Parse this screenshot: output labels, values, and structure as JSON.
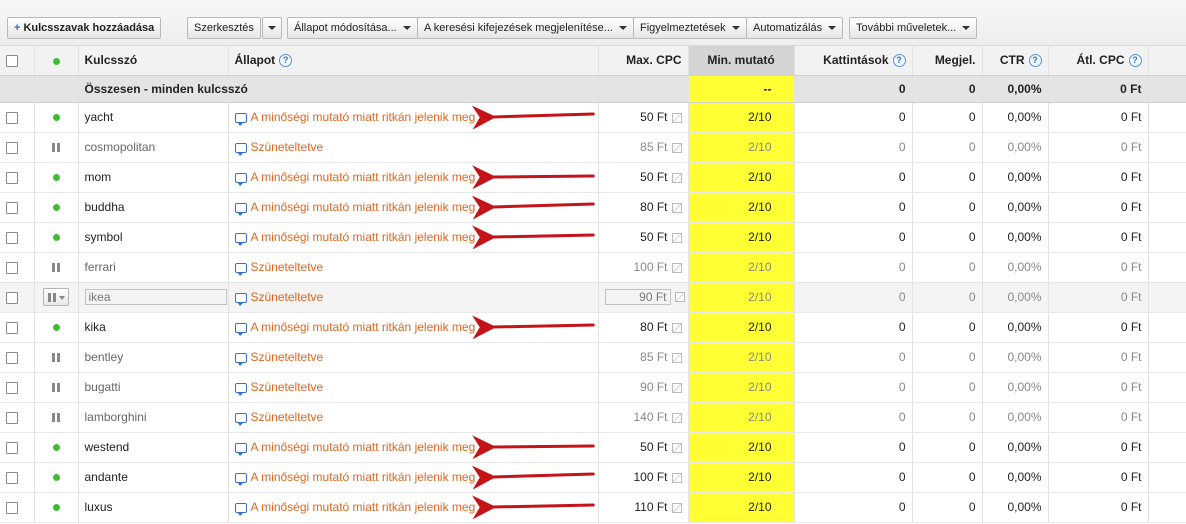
{
  "toolbar": {
    "add_keywords": "Kulcsszavak hozzáadása",
    "edit": "Szerkesztés",
    "change_status": "Állapot módosítása...",
    "search_terms": "A keresési kifejezések megjelenítése...",
    "alerts": "Figyelmeztetések",
    "automate": "Automatizálás",
    "more_actions": "További műveletek..."
  },
  "columns": {
    "keyword": "Kulcsszó",
    "status": "Állapot",
    "max_cpc": "Max. CPC",
    "min_score": "Min. mutató",
    "clicks": "Kattintások",
    "impressions": "Megjel.",
    "ctr": "CTR",
    "avg_cpc": "Átl. CPC"
  },
  "summary": {
    "label": "Összesen - minden kulcsszó",
    "min_score": "--",
    "clicks": "0",
    "impressions": "0",
    "ctr": "0,00%",
    "avg_cpc": "0 Ft"
  },
  "rows": [
    {
      "keyword": "yacht",
      "state": "active",
      "status": "A minőségi mutató miatt ritkán jelenik meg",
      "max_cpc": "50 Ft",
      "min_score": "2/10",
      "clicks": "0",
      "impressions": "0",
      "ctr": "0,00%",
      "avg_cpc": "0 Ft"
    },
    {
      "keyword": "cosmopolitan",
      "state": "paused",
      "status": "Szüneteltetve",
      "max_cpc": "85 Ft",
      "min_score": "2/10",
      "clicks": "0",
      "impressions": "0",
      "ctr": "0,00%",
      "avg_cpc": "0 Ft"
    },
    {
      "keyword": "mom",
      "state": "active",
      "status": "A minőségi mutató miatt ritkán jelenik meg",
      "max_cpc": "50 Ft",
      "min_score": "2/10",
      "clicks": "0",
      "impressions": "0",
      "ctr": "0,00%",
      "avg_cpc": "0 Ft"
    },
    {
      "keyword": "buddha",
      "state": "active",
      "status": "A minőségi mutató miatt ritkán jelenik meg",
      "max_cpc": "80 Ft",
      "min_score": "2/10",
      "clicks": "0",
      "impressions": "0",
      "ctr": "0,00%",
      "avg_cpc": "0 Ft"
    },
    {
      "keyword": "symbol",
      "state": "active",
      "status": "A minőségi mutató miatt ritkán jelenik meg",
      "max_cpc": "50 Ft",
      "min_score": "2/10",
      "clicks": "0",
      "impressions": "0",
      "ctr": "0,00%",
      "avg_cpc": "0 Ft"
    },
    {
      "keyword": "ferrari",
      "state": "paused",
      "status": "Szüneteltetve",
      "max_cpc": "100 Ft",
      "min_score": "2/10",
      "clicks": "0",
      "impressions": "0",
      "ctr": "0,00%",
      "avg_cpc": "0 Ft"
    },
    {
      "keyword": "ikea",
      "state": "paused-editing",
      "status": "Szüneteltetve",
      "max_cpc": "90 Ft",
      "min_score": "2/10",
      "clicks": "0",
      "impressions": "0",
      "ctr": "0,00%",
      "avg_cpc": "0 Ft"
    },
    {
      "keyword": "kika",
      "state": "active",
      "status": "A minőségi mutató miatt ritkán jelenik meg",
      "max_cpc": "80 Ft",
      "min_score": "2/10",
      "clicks": "0",
      "impressions": "0",
      "ctr": "0,00%",
      "avg_cpc": "0 Ft"
    },
    {
      "keyword": "bentley",
      "state": "paused",
      "status": "Szüneteltetve",
      "max_cpc": "85 Ft",
      "min_score": "2/10",
      "clicks": "0",
      "impressions": "0",
      "ctr": "0,00%",
      "avg_cpc": "0 Ft"
    },
    {
      "keyword": "bugatti",
      "state": "paused",
      "status": "Szüneteltetve",
      "max_cpc": "90 Ft",
      "min_score": "2/10",
      "clicks": "0",
      "impressions": "0",
      "ctr": "0,00%",
      "avg_cpc": "0 Ft"
    },
    {
      "keyword": "lamborghini",
      "state": "paused",
      "status": "Szüneteltetve",
      "max_cpc": "140 Ft",
      "min_score": "2/10",
      "clicks": "0",
      "impressions": "0",
      "ctr": "0,00%",
      "avg_cpc": "0 Ft"
    },
    {
      "keyword": "westend",
      "state": "active",
      "status": "A minőségi mutató miatt ritkán jelenik meg",
      "max_cpc": "50 Ft",
      "min_score": "2/10",
      "clicks": "0",
      "impressions": "0",
      "ctr": "0,00%",
      "avg_cpc": "0 Ft"
    },
    {
      "keyword": "andante",
      "state": "active",
      "status": "A minőségi mutató miatt ritkán jelenik meg",
      "max_cpc": "100 Ft",
      "min_score": "2/10",
      "clicks": "0",
      "impressions": "0",
      "ctr": "0,00%",
      "avg_cpc": "0 Ft"
    },
    {
      "keyword": "luxus",
      "state": "active",
      "status": "A minőségi mutató miatt ritkán jelenik meg",
      "max_cpc": "110 Ft",
      "min_score": "2/10",
      "clicks": "0",
      "impressions": "0",
      "ctr": "0,00%",
      "avg_cpc": "0 Ft"
    }
  ],
  "colors": {
    "highlight": "#ffff33",
    "arrow": "#c4141a",
    "status_text": "#e0661e",
    "active_dot": "#3cbf2f"
  }
}
